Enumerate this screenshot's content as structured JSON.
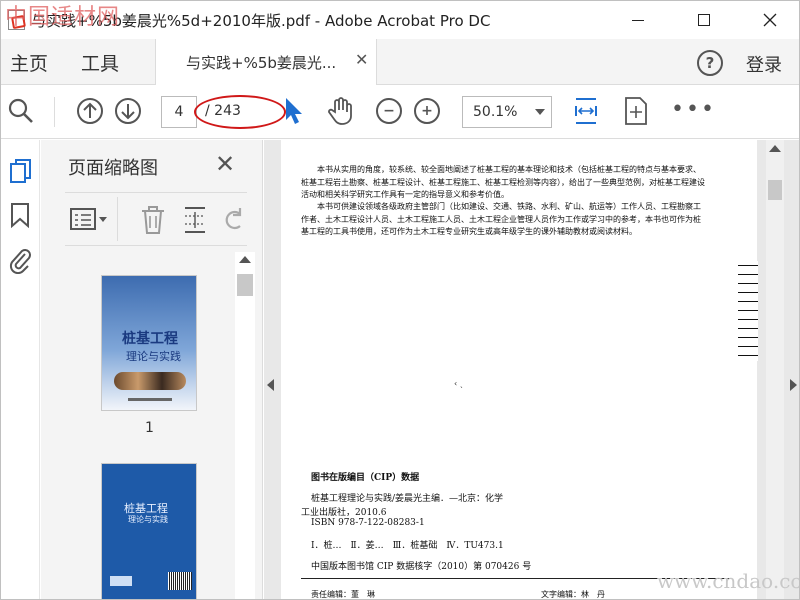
{
  "window": {
    "title": "与实践+%5b姜晨光%5d+2010年版.pdf - Adobe Acrobat Pro DC"
  },
  "watermark": {
    "top_left": "中国适材网",
    "bottom_right": "www.cndao.com"
  },
  "menu": {
    "home": "主页",
    "tools": "工具",
    "login": "登录"
  },
  "tab": {
    "label": "与实践+%5b姜晨光..."
  },
  "toolbar": {
    "current_page": "4",
    "total_pages": "/ 243",
    "zoom": "50.1%"
  },
  "thumbnails": {
    "title": "页面缩略图",
    "page1_label": "1",
    "cover1_title": "桩基工程",
    "cover1_subtitle": "理论与实践",
    "cover2_title": "桩基工程",
    "cover2_subtitle": "理论与实践"
  },
  "page": {
    "para1": "本书从实用的角度，较系统、较全面地阐述了桩基工程的基本理论和技术（包括桩基工程的特点与基本要求、桩基工程岩土勘察、桩基工程设计、桩基工程施工、桩基工程检测等内容），给出了一些典型范例，对桩基工程建设活动和相关科学研究工作具有一定的指导意义和参考价值。",
    "para2": "本书可供建设领域各级政府主管部门（比如建设、交通、铁路、水利、矿山、航运等）工作人员、工程勘察工作者、土木工程设计人员、土木工程施工人员、土木工程企业管理人员作为工作或学习中的参考，本书也可作为桩基工程的工具书使用，还可作为土木工程专业研究生或高年级学生的课外辅助教材或阅读材料。",
    "cip_title": "图书在版编目（CIP）数据",
    "cip_line1": "桩基工程理论与实践/姜晨光主编．—北京：化学",
    "cip_line2": "工业出版社，2010.6",
    "cip_line3": "ISBN 978-7-122-08283-1",
    "cip_line4": "Ⅰ．桩…　Ⅱ．姜…　Ⅲ．桩基础　Ⅳ．TU473.1",
    "cip_line5": "中国版本图书馆 CIP 数据核字（2010）第 070426 号",
    "credit1": "责任编辑：董　琳",
    "credit2": "文字编辑：林　丹"
  }
}
